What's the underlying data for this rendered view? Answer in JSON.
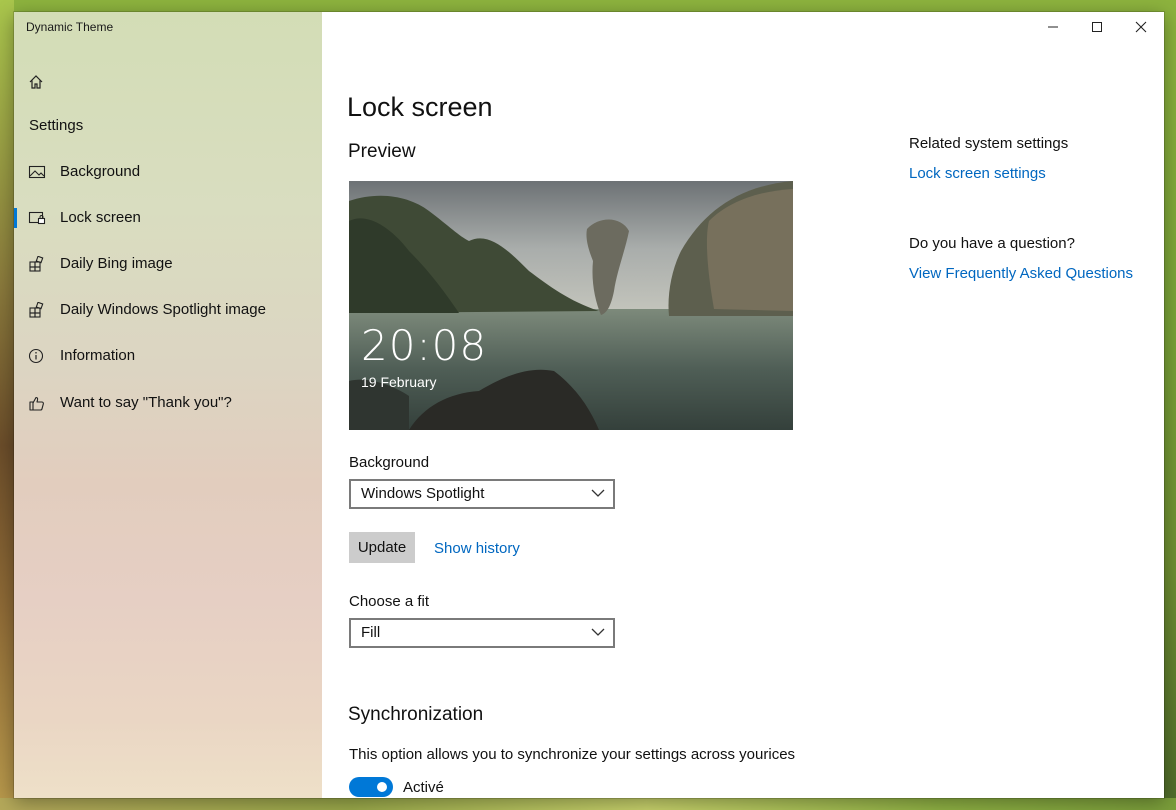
{
  "window": {
    "app_title": "Dynamic Theme"
  },
  "sidebar": {
    "header": "Settings",
    "items": [
      {
        "label": "Background",
        "icon": "picture-icon"
      },
      {
        "label": "Lock screen",
        "icon": "lock-screen-icon",
        "selected": true
      },
      {
        "label": "Daily Bing image",
        "icon": "tiles-icon"
      },
      {
        "label": "Daily Windows Spotlight image",
        "icon": "tiles-icon"
      },
      {
        "label": "Information",
        "icon": "info-icon"
      },
      {
        "label": "Want to say \"Thank you\"?",
        "icon": "thumbs-up-icon"
      }
    ]
  },
  "main": {
    "title": "Lock screen",
    "preview": {
      "heading": "Preview",
      "time": "20:08",
      "date": "19 February"
    },
    "background": {
      "label": "Background",
      "selected": "Windows Spotlight"
    },
    "update_button": "Update",
    "show_history_link": "Show history",
    "fit": {
      "label": "Choose a fit",
      "selected": "Fill"
    },
    "sync": {
      "heading": "Synchronization",
      "description": "This option allows you to synchronize your settings across yourices",
      "toggle_label": "Activé",
      "toggle_on": true
    }
  },
  "related": {
    "heading": "Related system settings",
    "link": "Lock screen settings",
    "question_heading": "Do you have a question?",
    "faq_link": "View Frequently Asked Questions"
  },
  "colors": {
    "accent": "#0078d7",
    "link": "#0067c0"
  }
}
